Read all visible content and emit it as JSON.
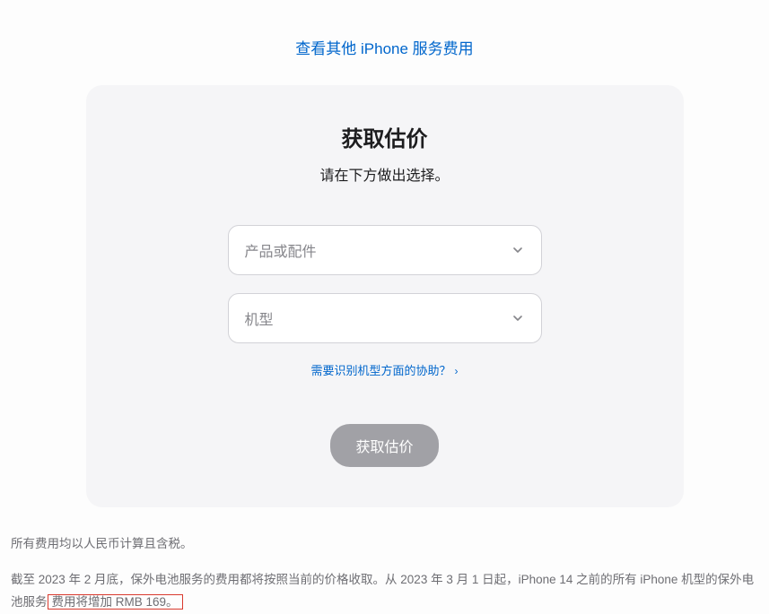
{
  "topLink": {
    "label": "查看其他 iPhone 服务费用"
  },
  "card": {
    "title": "获取估价",
    "subtitle": "请在下方做出选择。",
    "productSelect": {
      "placeholder": "产品或配件"
    },
    "modelSelect": {
      "placeholder": "机型"
    },
    "helpLink": {
      "label": "需要识别机型方面的协助？"
    },
    "submitButton": {
      "label": "获取估价"
    }
  },
  "footnotes": {
    "line1": "所有费用均以人民币计算且含税。",
    "line2_part1": "截至 2023 年 2 月底，保外电池服务的费用都将按照当前的价格收取。从 2023 年 3 月 1 日起，iPhone 14 之前的所有 iPhone 机型的保外电池服务",
    "line2_highlight": "费用将增加 RMB 169。"
  }
}
